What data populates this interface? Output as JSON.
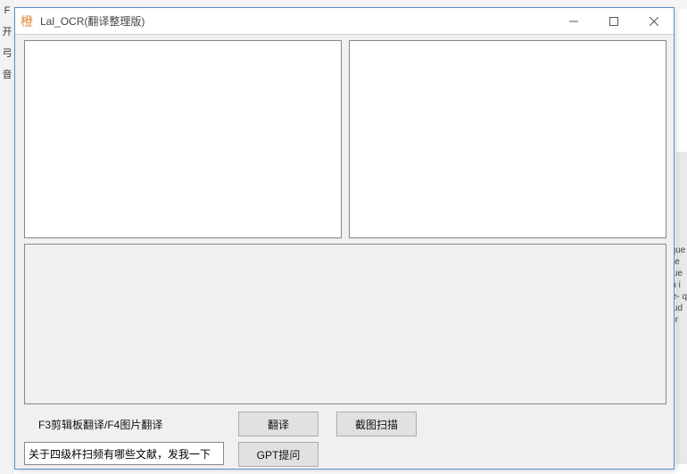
{
  "background": {
    "left_text": [
      "",
      "F",
      "开",
      "弓",
      "音"
    ],
    "right_text": "ents quen llecte ed w uen e on imat re- q plitu tude ole.ir"
  },
  "window": {
    "title": "Lal_OCR(翻译整理版)"
  },
  "panes": {
    "left_text": "",
    "right_text": ""
  },
  "hint": "F3剪辑板翻译/F4图片翻译",
  "buttons": {
    "translate": "翻译",
    "scan": "截图扫描",
    "gpt": "GPT提问"
  },
  "prompt": {
    "value": "关于四级杆扫频有哪些文献，发我一下"
  }
}
